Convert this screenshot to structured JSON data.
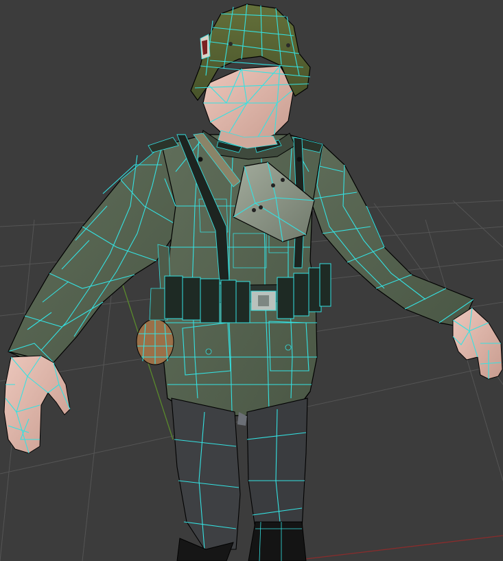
{
  "viewport": {
    "background": "#3c3c3c",
    "wireframe_color": "#34e2e2",
    "grid_color": "#555555",
    "axis_y_color": "#5a8a2c",
    "axis_x_color": "#8a2c2c"
  },
  "model": {
    "uniform_color": "#56634f",
    "skin_color": "#e3b9ad",
    "helmet_color": "#56622f",
    "trousers_color": "#3e4043",
    "belt_color": "#1e2a24",
    "pouch_color": "#8a9484",
    "grenade_color": "#9b7048"
  }
}
